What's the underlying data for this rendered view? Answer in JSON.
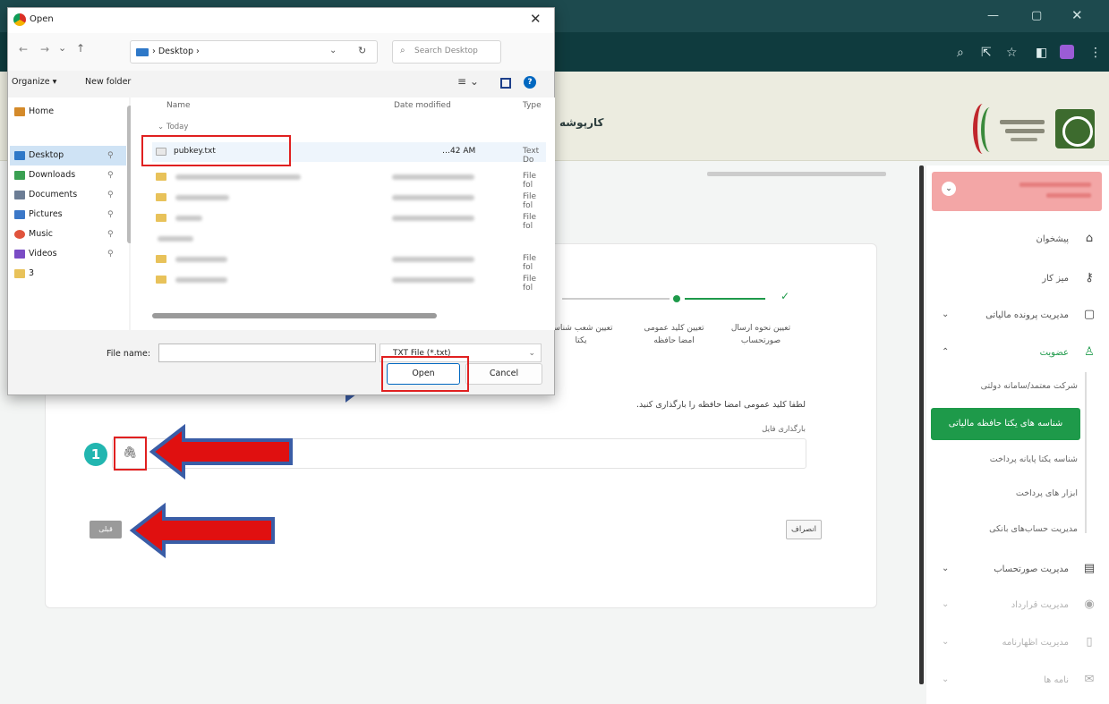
{
  "dialog": {
    "title": "Open",
    "close": "✕",
    "path": "Desktop",
    "search_placeholder": "Search Desktop",
    "organize": "Organize ▾",
    "new_folder": "New folder",
    "nav": [
      {
        "label": "Home",
        "color": "#d48a2a"
      },
      {
        "label": "Desktop",
        "color": "#2e78c8"
      },
      {
        "label": "Downloads",
        "color": "#3aa052"
      },
      {
        "label": "Documents",
        "color": "#6c7d95"
      },
      {
        "label": "Pictures",
        "color": "#3b78c8"
      },
      {
        "label": "Music",
        "color": "#e0533c"
      },
      {
        "label": "Videos",
        "color": "#7a4cc5"
      },
      {
        "label": "3",
        "color": "#e8c25a"
      }
    ],
    "columns": {
      "name": "Name",
      "date": "Date modified",
      "type": "Type"
    },
    "group_today": "Today",
    "selected_file": {
      "name": "pubkey.txt",
      "date": "…42 AM",
      "type": "Text Do"
    },
    "folder_type": "File fol",
    "file_name_label": "File name:",
    "file_type": "TXT File (*.txt)",
    "open": "Open",
    "cancel": "Cancel"
  },
  "site": {
    "cartable": "کارپوشه",
    "stepper": [
      {
        "label": "تعیین نحوه ارسال صورتحساب"
      },
      {
        "label": "تعیین کلید عمومی امضا حافظه"
      },
      {
        "label": "تعیین شعب شناسه یکتا"
      }
    ],
    "instruction": "لطفا کلید عمومی امضا حافظه را بارگذاری کنید.",
    "upload_label": "بارگذاری فایل",
    "prev_button": "قبلی",
    "cancel_button": "انصراف"
  },
  "sidebar": {
    "items": [
      {
        "label": "پیشخوان",
        "icon": "home-icon"
      },
      {
        "label": "میز کار",
        "icon": "key-icon"
      },
      {
        "label": "مدیریت پرونده مالیاتی",
        "icon": "document-icon"
      },
      {
        "label": "عضویت",
        "icon": "user-icon"
      }
    ],
    "subitems": [
      {
        "label": "شرکت معتمد/سامانه دولتی"
      },
      {
        "label": "شناسه های یکتا حافظه مالیاتی"
      },
      {
        "label": "شناسه یکتا پایانه پرداخت"
      },
      {
        "label": "ابزار های پرداخت"
      },
      {
        "label": "مدیریت حساب‌های بانکی"
      }
    ],
    "more": [
      {
        "label": "مدیریت صورتحساب",
        "icon": "invoice-icon"
      },
      {
        "label": "مدیریت قرارداد",
        "icon": "eye-icon"
      },
      {
        "label": "مدیریت اظهارنامه",
        "icon": "clipboard-icon"
      },
      {
        "label": "نامه ها",
        "icon": "chat-icon"
      }
    ]
  },
  "callouts": {
    "badge": "1"
  },
  "colors": {
    "teal": "#22b6b0",
    "red_arrow": "#e01010",
    "arrow_blue": "#3a5da6",
    "green": "#1e9a4a"
  }
}
